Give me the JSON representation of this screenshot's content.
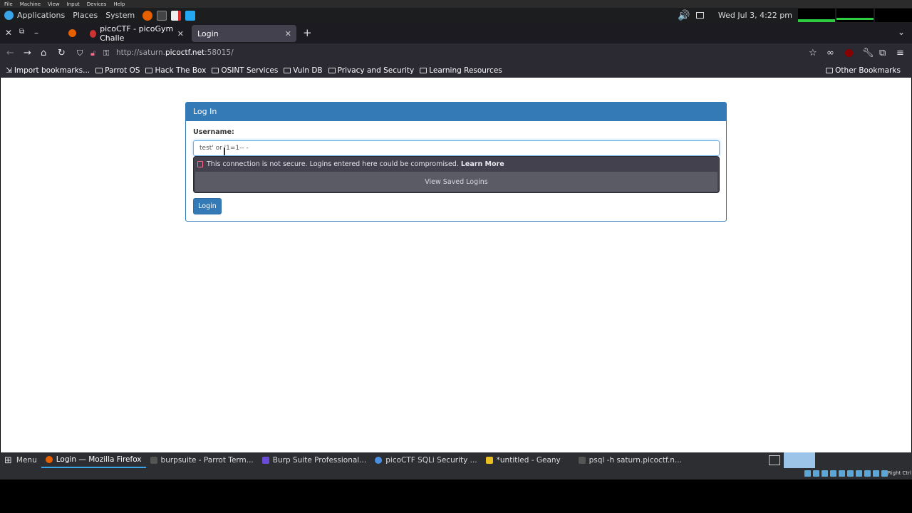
{
  "vm_menu": [
    "File",
    "Machine",
    "View",
    "Input",
    "Devices",
    "Help"
  ],
  "panel": {
    "applications": "Applications",
    "places": "Places",
    "system": "System",
    "datetime": "Wed Jul 3,  4:22 pm"
  },
  "tabs": [
    {
      "label": "picoCTF - picoGym Challe"
    },
    {
      "label": "Login"
    }
  ],
  "url": {
    "prefix": "http://saturn.",
    "host": "picoctf.net",
    "suffix": ":58015/"
  },
  "bookmarks": {
    "import": "Import bookmarks...",
    "folders": [
      "Parrot OS",
      "Hack The Box",
      "OSINT Services",
      "Vuln DB",
      "Privacy and Security",
      "Learning Resources"
    ],
    "other": "Other Bookmarks"
  },
  "login": {
    "heading": "Log In",
    "username_label": "Username:",
    "username_value": "test' or '1=1-- -",
    "insecure_warning": "This connection is not secure. Logins entered here could be compromised.",
    "learn_more": "Learn More",
    "view_saved": "View Saved Logins",
    "button": "Login"
  },
  "taskbar": {
    "menu": "Menu",
    "items": [
      "Login — Mozilla Firefox",
      "burpsuite - Parrot Term...",
      "Burp Suite Professional...",
      "picoCTF SQLi Security ...",
      "*untitled - Geany",
      "psql -h saturn.picoctf.n..."
    ]
  },
  "tray": {
    "keyboard": "Right Ctrl"
  },
  "colors": {
    "primary": "#337ab7",
    "tab_active": "#42414d",
    "toolbar": "#2b2a33"
  }
}
